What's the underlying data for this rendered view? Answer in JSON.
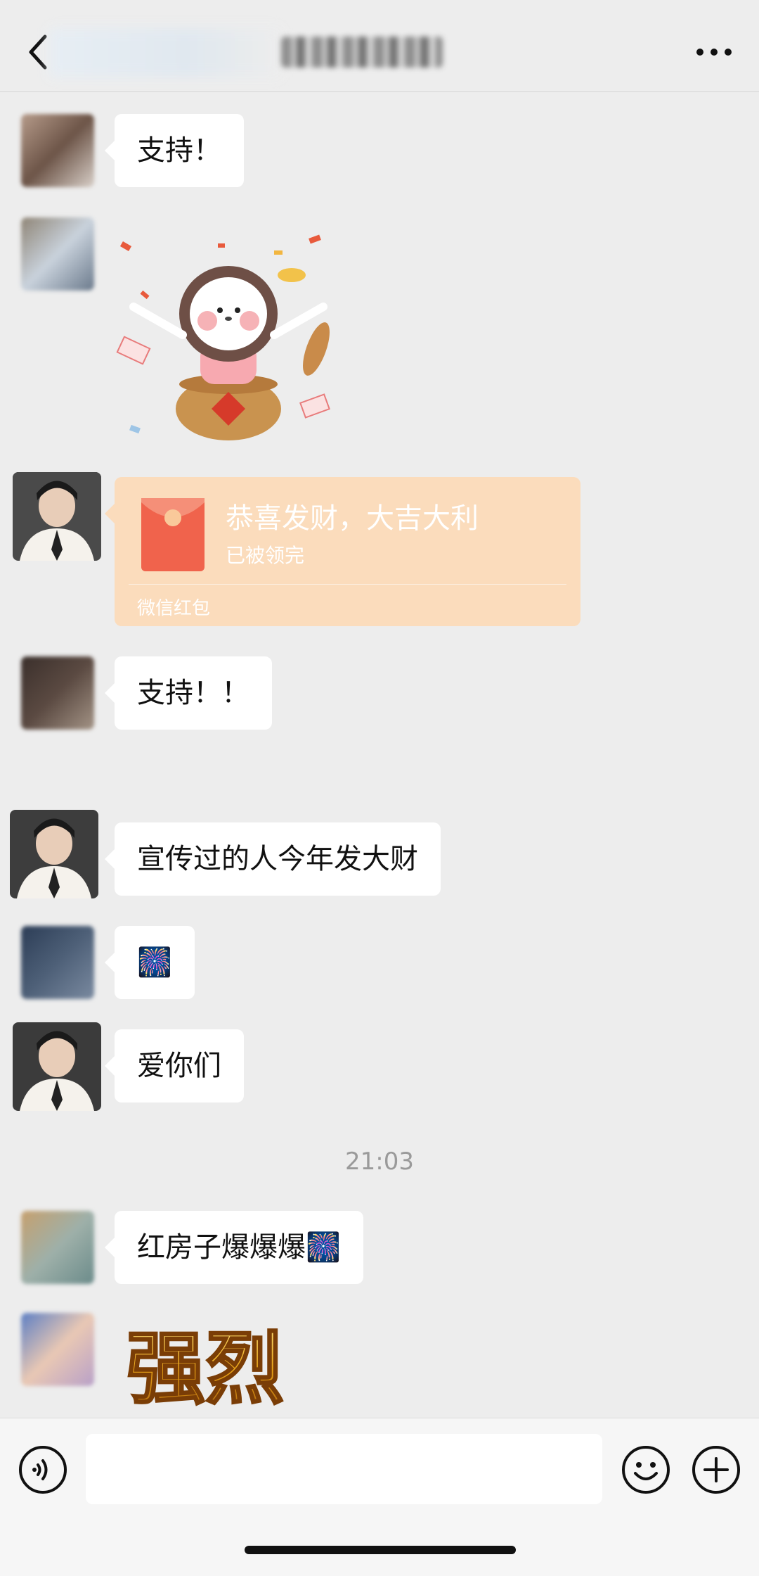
{
  "header": {
    "title": "",
    "back_icon": "chevron-left-icon",
    "more_icon": "more-horizontal-icon"
  },
  "messages": [
    {
      "type": "text",
      "text": "支持！"
    },
    {
      "type": "sticker",
      "description_icon": "fortune-girl-sticker"
    },
    {
      "type": "red-packet",
      "title": "恭喜发财，大吉大利",
      "status": "已被领完",
      "footer": "微信红包"
    },
    {
      "type": "text",
      "text": "支持！！"
    },
    {
      "type": "text",
      "text": "宣传过的人今年发大财"
    },
    {
      "type": "emoji",
      "text": "🎆"
    },
    {
      "type": "text",
      "text": "爱你们"
    },
    {
      "type": "timestamp",
      "text": "21:03"
    },
    {
      "type": "text",
      "text": "红房子爆爆爆🎆"
    },
    {
      "type": "sticker",
      "text": "强烈"
    }
  ],
  "colors": {
    "background": "#ededed",
    "bubble": "#ffffff",
    "red_packet": "#fbdcbc",
    "sticker_gold": "#e8a317"
  },
  "input_bar": {
    "placeholder": "",
    "voice_icon": "voice-icon",
    "emoji_icon": "emoji-icon",
    "plus_icon": "plus-circle-icon"
  }
}
